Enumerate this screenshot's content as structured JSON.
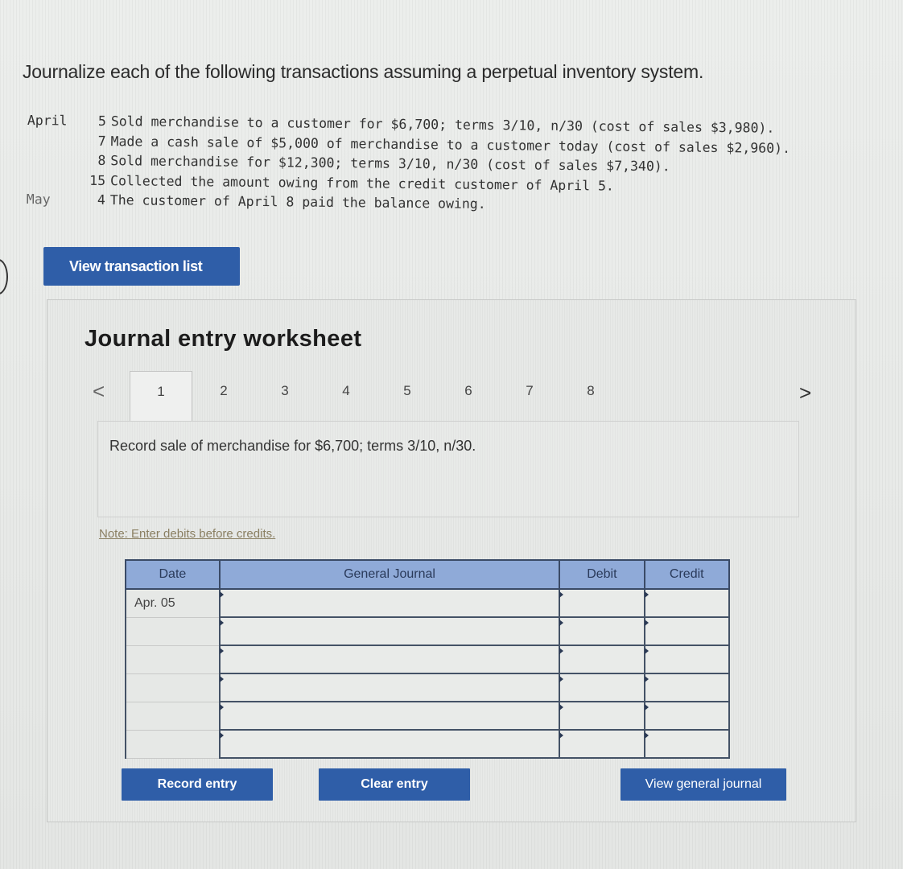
{
  "instruction": "Journalize each of the following transactions assuming a perpetual inventory system.",
  "transactions": [
    {
      "month": "April",
      "day": "5",
      "text": "Sold merchandise to a customer for $6,700; terms 3/10, n/30 (cost of sales $3,980)."
    },
    {
      "month": "",
      "day": "7",
      "text": "Made a cash sale of $5,000 of merchandise to a customer today (cost of sales $2,960)."
    },
    {
      "month": "",
      "day": "8",
      "text": "Sold merchandise for $12,300; terms 3/10, n/30 (cost of sales $7,340)."
    },
    {
      "month": "",
      "day": "15",
      "text": "Collected the amount owing from the credit customer of April 5."
    },
    {
      "month": "May",
      "day": "4",
      "text": "The customer of April 8 paid the balance owing."
    }
  ],
  "view_transaction_list_label": "View transaction list",
  "worksheet": {
    "title": "Journal entry worksheet",
    "nav_prev": "<",
    "nav_next": ">",
    "tabs": [
      "1",
      "2",
      "3",
      "4",
      "5",
      "6",
      "7",
      "8"
    ],
    "active_tab": "1",
    "prompt": "Record sale of merchandise for $6,700; terms 3/10, n/30.",
    "note": "Note: Enter debits before credits.",
    "table": {
      "headers": {
        "date": "Date",
        "account": "General Journal",
        "debit": "Debit",
        "credit": "Credit"
      },
      "rows": [
        {
          "date": "Apr. 05",
          "account": "",
          "debit": "",
          "credit": ""
        },
        {
          "date": "",
          "account": "",
          "debit": "",
          "credit": ""
        },
        {
          "date": "",
          "account": "",
          "debit": "",
          "credit": ""
        },
        {
          "date": "",
          "account": "",
          "debit": "",
          "credit": ""
        },
        {
          "date": "",
          "account": "",
          "debit": "",
          "credit": ""
        },
        {
          "date": "",
          "account": "",
          "debit": "",
          "credit": ""
        }
      ]
    },
    "buttons": {
      "record": "Record entry",
      "clear": "Clear entry",
      "view_journal": "View general journal"
    }
  },
  "colors": {
    "button": "#2f5ea8",
    "table_header": "#8faad8"
  }
}
